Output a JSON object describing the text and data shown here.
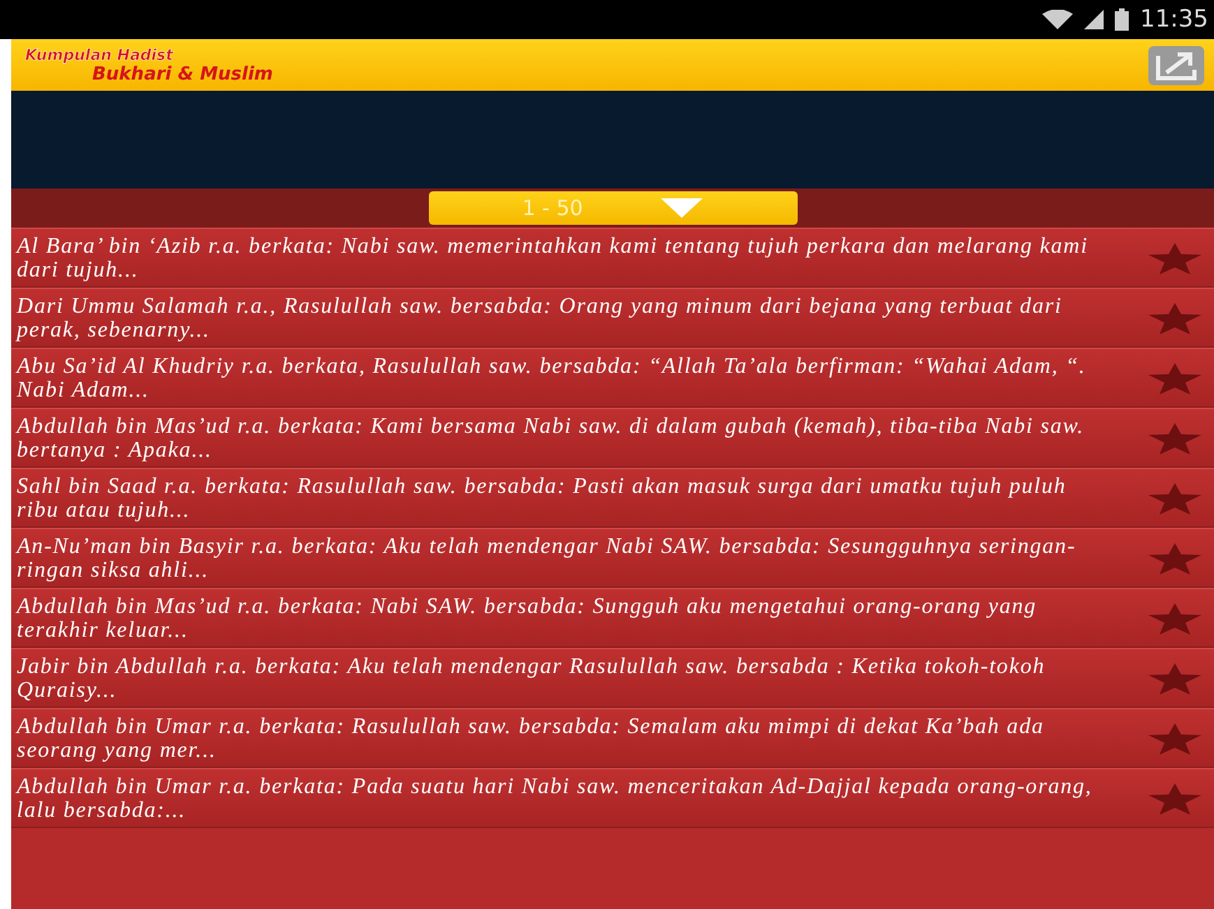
{
  "status_bar": {
    "time": "11:35"
  },
  "header": {
    "title_line_1": "Kumpulan Hadist",
    "title_line_2": "Bukhari & Muslim"
  },
  "range_selector": {
    "value": "1 - 50"
  },
  "hadith_list": [
    {
      "text": "Al Bara’ bin ‘Azib r.a. berkata: Nabi saw. memerintahkan kami tentang tujuh perkara dan melarang kami dari tujuh..."
    },
    {
      "text": "Dari Ummu Salamah r.a., Rasulullah saw. bersabda: Orang yang minum dari bejana yang terbuat dari perak, sebenarny..."
    },
    {
      "text": "Abu Sa’id Al Khudriy r.a. berkata, Rasulullah saw. bersabda: “Allah Ta’ala berfirman: “Wahai Adam, “. Nabi Adam..."
    },
    {
      "text": "Abdullah bin Mas’ud r.a. berkata: Kami bersama Nabi saw. di dalam gubah (kemah), tiba-tiba Nabi saw. bertanya : Apaka..."
    },
    {
      "text": "Sahl bin Saad r.a. berkata: Rasulullah saw. bersabda: Pasti akan masuk surga dari umatku tujuh puluh ribu atau tujuh..."
    },
    {
      "text": "An-Nu’man bin Basyir r.a. berkata: Aku telah mendengar Nabi SAW. bersabda: Sesungguhnya seringan-ringan siksa ahli..."
    },
    {
      "text": "Abdullah bin Mas’ud r.a. berkata: Nabi SAW. bersabda: Sungguh aku mengetahui orang-orang yang terakhir keluar..."
    },
    {
      "text": "Jabir bin Abdullah r.a. berkata: Aku telah mendengar Rasulullah saw. bersabda : Ketika tokoh-tokoh Quraisy..."
    },
    {
      "text": "Abdullah bin Umar r.a. berkata: Rasulullah saw. bersabda: Semalam aku mimpi di dekat Ka’bah ada seorang yang mer..."
    },
    {
      "text": "Abdullah bin Umar r.a. berkata: Pada suatu hari Nabi saw. menceritakan Ad-Dajjal kepada orang-orang, lalu bersabda:..."
    }
  ]
}
